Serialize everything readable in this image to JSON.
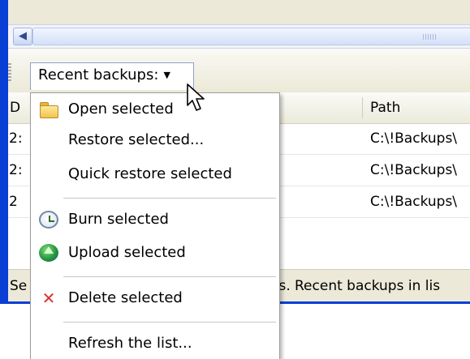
{
  "toolbar": {
    "recent_label": "Recent backups:",
    "dropdown_arrow": "▼"
  },
  "list": {
    "col_date_header": "D",
    "col_path_header": "Path",
    "rows": [
      {
        "c1": "2:",
        "path": "C:\\!Backups\\"
      },
      {
        "c1": "2:",
        "path": "C:\\!Backups\\"
      },
      {
        "c1": "2",
        "path": "C:\\!Backups\\"
      }
    ]
  },
  "status": {
    "left": "Se",
    "middle": "es.",
    "right": "Recent backups in lis"
  },
  "menu": {
    "items": [
      {
        "label": "Open selected",
        "icon": "folder-icon"
      },
      {
        "label": "Restore selected..."
      },
      {
        "label": "Quick restore selected"
      },
      {
        "label": "Burn selected",
        "icon": "clock-icon"
      },
      {
        "label": "Upload selected",
        "icon": "globe-icon"
      },
      {
        "label": "Delete selected",
        "icon": "delete-icon"
      },
      {
        "label": "Refresh the list..."
      }
    ]
  },
  "colors": {
    "window_border": "#0a3fd6",
    "menu_bg": "#ffffff",
    "delete_red": "#d8342b"
  }
}
